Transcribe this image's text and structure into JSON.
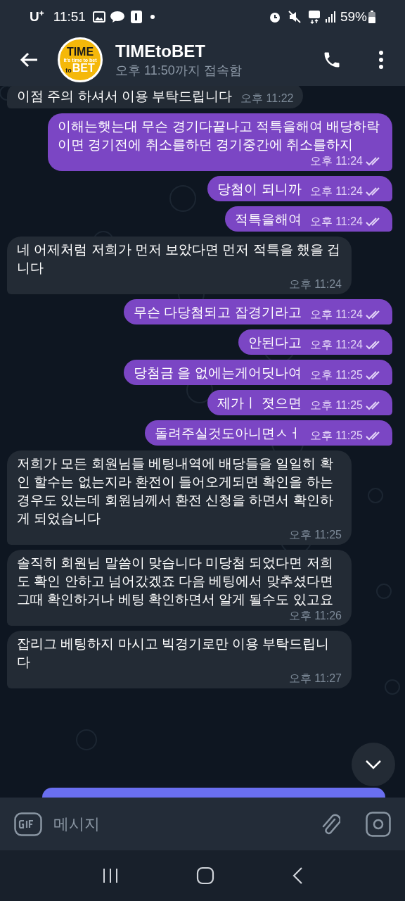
{
  "status_bar": {
    "carrier": "U⁺",
    "time": "11:51",
    "battery": "59%"
  },
  "header": {
    "avatar_lines": [
      "TIME",
      "to",
      "BET"
    ],
    "avatar_tagline": "It's time to bet",
    "title": "TIMEtoBET",
    "subtitle": "오후 11:50까지 접속함"
  },
  "messages": [
    {
      "kind": "in",
      "text": "이점 주의 하셔서 이용 부탁드립니다",
      "time": "오후 11:22"
    },
    {
      "kind": "out",
      "text": "이해는햇는대  무슨 경기다끝나고 적특을해여 배당하락이면 경기전에 취소를하던 경기중간에 취소를하지",
      "time": "오후 11:24",
      "read": true
    },
    {
      "kind": "out",
      "text": "당첨이 되니까",
      "time": "오후 11:24",
      "read": true
    },
    {
      "kind": "out",
      "text": "적특을해여",
      "time": "오후 11:24",
      "read": true
    },
    {
      "kind": "in",
      "text": "네 어제처럼 저희가 먼저 보았다면 먼저 적특을 했을 겁니다",
      "time": "오후 11:24"
    },
    {
      "kind": "out",
      "text": "무슨 다당첨되고 잡경기라고",
      "time": "오후 11:24",
      "read": true
    },
    {
      "kind": "out",
      "text": "안된다고",
      "time": "오후 11:24",
      "read": true
    },
    {
      "kind": "out",
      "text": "당첨금 을 없에는게어딧나여",
      "time": "오후 11:25",
      "read": true
    },
    {
      "kind": "out",
      "text": "제가ㅣ 졋으면",
      "time": "오후 11:25",
      "read": true
    },
    {
      "kind": "out",
      "text": "돌려주실것도아니면ㅅㅓ",
      "time": "오후 11:25",
      "read": true
    },
    {
      "kind": "in",
      "text": "저희가 모든 회원님들 베팅내역에 배당들을 일일히 확인 할수는 없는지라 환전이 들어오게되면 확인을 하는 경우도 있는데 회원님께서 환전 신청을 하면서 확인하게 되었습니다",
      "time": "오후 11:25"
    },
    {
      "kind": "in",
      "text": "솔직히 회원님 말씀이 맞습니다 미당첨 되었다면 저희도 확인 안하고 넘어갔겠죠 다음 베팅에서 맞추셨다면 그때 확인하거나 베팅 확인하면서 알게 될수도 있고요",
      "time": "오후 11:26"
    },
    {
      "kind": "in",
      "text": "잡리그 베팅하지 마시고 빅경기로만 이용 부탁드립니다",
      "time": "오후 11:27"
    }
  ],
  "composer": {
    "placeholder": "메시지"
  }
}
